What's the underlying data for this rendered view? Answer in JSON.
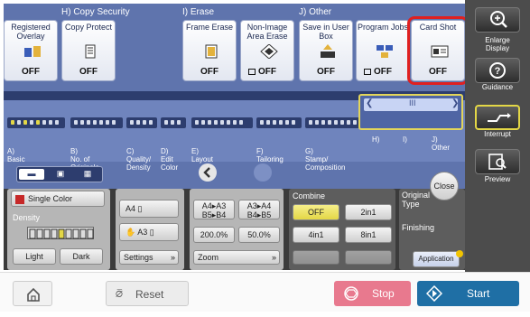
{
  "sections": {
    "copy_security": "H)  Copy Security",
    "erase": "I)   Erase",
    "other": "J)   Other"
  },
  "function_buttons": [
    {
      "label": "Registered Overlay",
      "state": "OFF",
      "icon": "overlay-icon"
    },
    {
      "label": "Copy Protect",
      "state": "OFF",
      "icon": "copy-protect-icon"
    },
    {
      "label": "Frame Erase",
      "state": "OFF",
      "icon": "frame-erase-icon"
    },
    {
      "label": "Non-Image Area Erase",
      "state": "OFF",
      "icon": "non-image-erase-icon"
    },
    {
      "label": "Save in User Box",
      "state": "OFF",
      "icon": "save-user-box-icon"
    },
    {
      "label": "Program Jobs",
      "state": "OFF",
      "icon": "program-jobs-icon"
    },
    {
      "label": "Card Shot",
      "state": "OFF",
      "icon": "card-shot-icon"
    }
  ],
  "tabs": [
    {
      "label": "A)\nBasic"
    },
    {
      "label": "B)\nNo. of\nOriginals"
    },
    {
      "label": "C)\nQuality/\nDensity"
    },
    {
      "label": "D)\nEdit\nColor"
    },
    {
      "label": "E)\nLayout"
    },
    {
      "label": "F)\nTailoring"
    },
    {
      "label": "G)\nStamp/\nComposition"
    },
    {
      "label": "H)"
    },
    {
      "label": "I)"
    },
    {
      "label": "J)\nOther"
    }
  ],
  "lower": {
    "color": "Single Color",
    "density_title": "Density",
    "light": "Light",
    "dark": "Dark",
    "paper1": "A4",
    "paper2": "A3",
    "settings": "Settings",
    "zoom_opts": [
      "A4▸A3\nB5▸B4",
      "A3▸A4\nB4▸B5",
      "200.0%",
      "50.0%"
    ],
    "zoom": "Zoom",
    "combine_title": "Combine",
    "combine_opts": [
      "OFF",
      "2in1",
      "4in1",
      "8in1"
    ],
    "original_type": "Original Type",
    "finishing": "Finishing",
    "application": "Application",
    "close": "Close"
  },
  "side": {
    "enlarge": "Enlarge\nDisplay",
    "guidance": "Guidance",
    "interrupt": "Interrupt",
    "preview": "Preview"
  },
  "bottom": {
    "reset": "Reset",
    "stop": "Stop",
    "start": "Start"
  },
  "colors": {
    "panel": "#5f74ad",
    "selected_outline": "#e02020",
    "stop": "#e8798e",
    "start": "#1f6fa5"
  }
}
